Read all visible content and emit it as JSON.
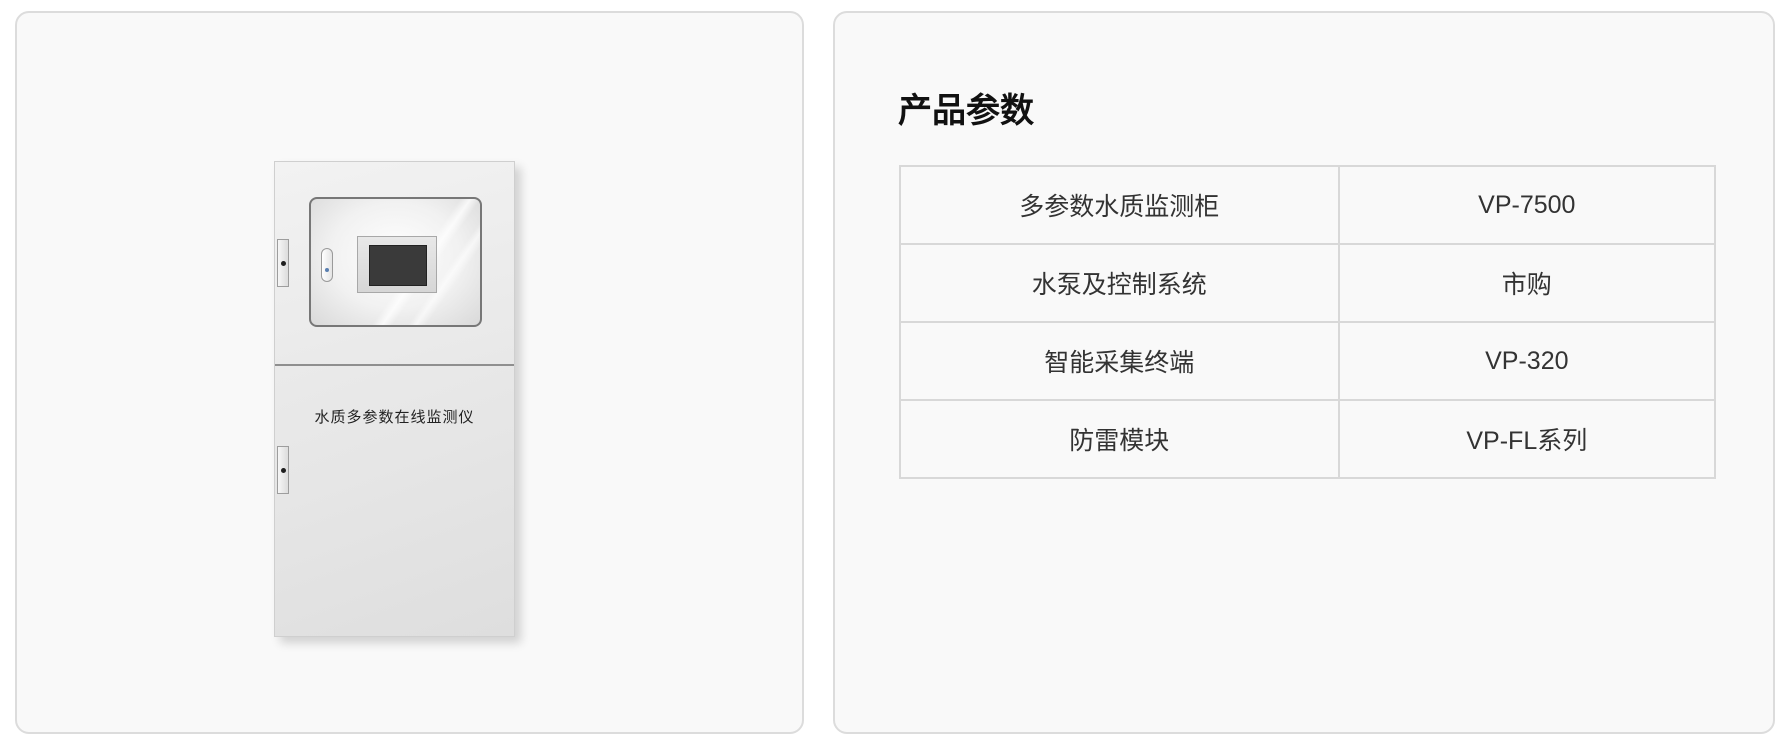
{
  "product_image": {
    "cabinet_label": "水质多参数在线监测仪"
  },
  "params": {
    "title": "产品参数",
    "rows": [
      {
        "name": "多参数水质监测柜",
        "value": "VP-7500"
      },
      {
        "name": "水泵及控制系统",
        "value": "市购"
      },
      {
        "name": "智能采集终端",
        "value": "VP-320"
      },
      {
        "name": "防雷模块",
        "value": "VP-FL系列"
      }
    ]
  },
  "colors": {
    "panel_background": "#f9f9f9",
    "panel_border": "#dcdcdc",
    "table_border": "#d8d8d8",
    "text": "#333333"
  }
}
